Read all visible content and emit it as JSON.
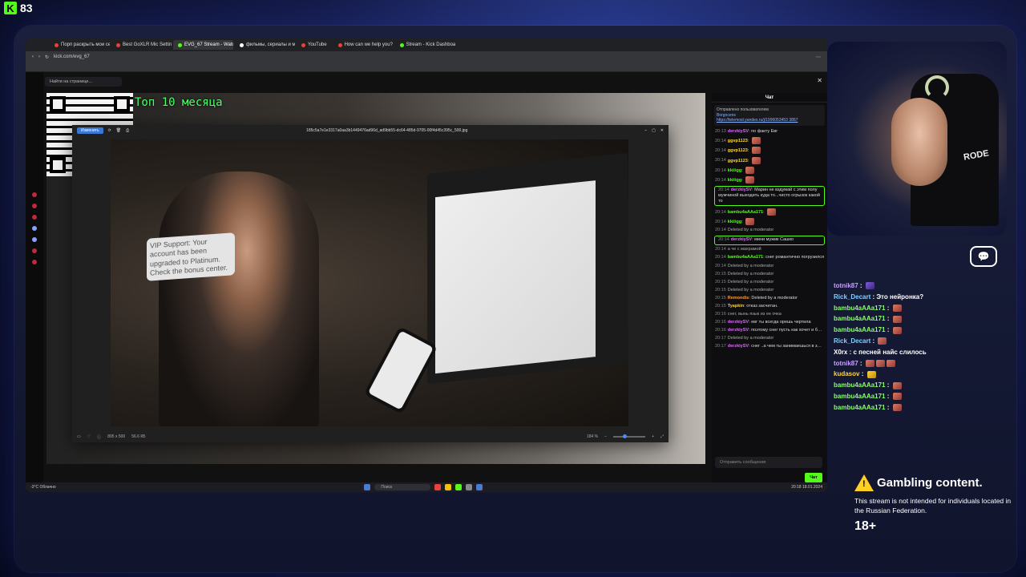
{
  "overlay": {
    "viewer_count": "83"
  },
  "browser": {
    "tabs": [
      {
        "label": "Порп раскрыть мои сек",
        "color": "#e8423f",
        "active": false
      },
      {
        "label": "Best GoXLR Mic Settings",
        "color": "#e8423f",
        "active": false
      },
      {
        "label": "EVG_67 Stream - Watch",
        "color": "#53fc18",
        "active": true
      },
      {
        "label": "фильмы, сериалы и муз",
        "color": "#ffffff",
        "active": false
      },
      {
        "label": "YouTube",
        "color": "#e8423f",
        "active": false
      },
      {
        "label": "How can we help you? -",
        "color": "#e8423f",
        "active": false
      },
      {
        "label": "Stream - Kick Dashboard",
        "color": "#53fc18",
        "active": false
      }
    ],
    "url": "kick.com/evg_67",
    "find_placeholder": "Найти на странице..."
  },
  "stream": {
    "top_label": "Топ 10 месяца",
    "viewer": {
      "edit_label": "Изменить",
      "filename": "185c5a7e1e3317a0aa3b1449476ad96d_ad9bb55-dc64-485d-9705-00f4d45c395c_500.jpg",
      "monitor_text": "VIP Support: Your account has been upgraded to Platinum. Check the bonus center.",
      "dimensions": "895 x 500",
      "filesize": "56.6 КБ",
      "zoom": "184 %"
    }
  },
  "kick_chat": {
    "header": "Чат",
    "pinned_label": "Отправлено пользователем",
    "pinned_user": "Borgocens",
    "pinned_link": "https://telemost.yandex.ru/j/1996053453 3867",
    "messages": [
      {
        "time": "20:13",
        "user": "derzkiySV",
        "color": "#e066ff",
        "text": "по факту Евг"
      },
      {
        "time": "20:14",
        "user": "ggvp1123",
        "color": "#ffd633",
        "text": ""
      },
      {
        "time": "20:14",
        "user": "ggvp1123",
        "color": "#ffd633",
        "text": ""
      },
      {
        "time": "20:14",
        "user": "ggvp1123",
        "color": "#ffd633",
        "text": ""
      },
      {
        "time": "20:14",
        "user": "kkiiigg",
        "color": "#53fc18",
        "text": ""
      },
      {
        "time": "20:14",
        "user": "kkiiigg",
        "color": "#53fc18",
        "text": ""
      },
      {
        "time": "20:14",
        "user": "derzkiySV",
        "color": "#e066ff",
        "text": "Марин не вздумай с этим полу мужчиной выходить куда то...чисто огрызок какой то",
        "hl": true
      },
      {
        "time": "20:14",
        "user": "bambu4aAAa171",
        "color": "#53fc18",
        "text": ""
      },
      {
        "time": "20:14",
        "user": "kkiiigg",
        "color": "#53fc18",
        "text": ""
      },
      {
        "time": "20:14",
        "user": "",
        "color": "#e8423f",
        "text": "Deleted by a moderator"
      },
      {
        "time": "20:14",
        "user": "derzkiySV",
        "color": "#e066ff",
        "text": "мини мужик Сашко",
        "hl": true
      },
      {
        "time": "20:14",
        "user": "",
        "color": "#e8423f",
        "text": "а че с махрамой"
      },
      {
        "time": "20:14",
        "user": "bambu4aAAa171",
        "color": "#53fc18",
        "text": "снег романтично погрузился"
      },
      {
        "time": "20:14",
        "user": "",
        "color": "#e8423f",
        "text": "Deleted by a moderator"
      },
      {
        "time": "20:15",
        "user": "",
        "color": "#e8423f",
        "text": "Deleted by a moderator"
      },
      {
        "time": "20:15",
        "user": "",
        "color": "#e8423f",
        "text": "Deleted by a moderator"
      },
      {
        "time": "20:15",
        "user": "",
        "color": "#e8423f",
        "text": "Deleted by a moderator"
      },
      {
        "time": "20:15",
        "user": "Remondis",
        "color": "#ff9933",
        "text": "Deleted by a moderator"
      },
      {
        "time": "20:15",
        "user": "Tyapkin",
        "color": "#ffd633",
        "text": "отказ засчитан."
      },
      {
        "time": "20:16",
        "user": "",
        "color": "#e8423f",
        "text": "снег, вынь язык из ее очка"
      },
      {
        "time": "20:16",
        "user": "derzkiySV",
        "color": "#e066ff",
        "text": "евг ты всегда орешь чертила"
      },
      {
        "time": "20:16",
        "user": "derzkiySV",
        "color": "#e066ff",
        "text": "поэтому снег пусть как хочет и базарит"
      },
      {
        "time": "20:17",
        "user": "",
        "color": "#e8423f",
        "text": "Deleted by a moderator"
      },
      {
        "time": "20:17",
        "user": "derzkiySV",
        "color": "#e066ff",
        "text": "снег ..а чем ты занимаешься в зале?"
      }
    ],
    "input_placeholder": "Отправить сообщение",
    "send_label": "Чат"
  },
  "taskbar": {
    "weather_temp": "-3°C",
    "weather_desc": "Облачно",
    "search_label": "Поиск",
    "time": "20:18",
    "date": "18.01.2024"
  },
  "webcam": {
    "mic_brand": "RODE"
  },
  "overlay_chat": [
    {
      "user": "totnik87",
      "color": "#c9a0ff",
      "text": "",
      "emotes": [
        "p"
      ]
    },
    {
      "user": "Rick_Decart",
      "color": "#7fd1ff",
      "text": "Это нейронка?",
      "emotes": []
    },
    {
      "user": "bambu4aAAa171",
      "color": "#8aff6a",
      "text": "",
      "emotes": [
        "r"
      ]
    },
    {
      "user": "bambu4aAAa171",
      "color": "#8aff6a",
      "text": "",
      "emotes": [
        "r"
      ]
    },
    {
      "user": "bambu4aAAa171",
      "color": "#8aff6a",
      "text": "",
      "emotes": [
        "r"
      ]
    },
    {
      "user": "Rick_Decart",
      "color": "#7fd1ff",
      "text": "",
      "emotes": [
        "r"
      ]
    },
    {
      "user": "X0rx",
      "color": "#ffffff",
      "text": "с песней найс слилось",
      "emotes": []
    },
    {
      "user": "totnik87",
      "color": "#c9a0ff",
      "text": "",
      "emotes": [
        "r",
        "r",
        "r"
      ]
    },
    {
      "user": "kudasov",
      "color": "#ffd633",
      "text": "",
      "emotes": [
        "y"
      ]
    },
    {
      "user": "bambu4aAAa171",
      "color": "#8aff6a",
      "text": "",
      "emotes": [
        "r"
      ]
    },
    {
      "user": "bambu4aAAa171",
      "color": "#8aff6a",
      "text": "",
      "emotes": [
        "r"
      ]
    },
    {
      "user": "bambu4aAAa171",
      "color": "#8aff6a",
      "text": "",
      "emotes": [
        "r"
      ]
    }
  ],
  "gambling": {
    "title": "Gambling content.",
    "desc": "This stream is not intended for individuals located in the Russian Federation.",
    "age": "18+"
  }
}
